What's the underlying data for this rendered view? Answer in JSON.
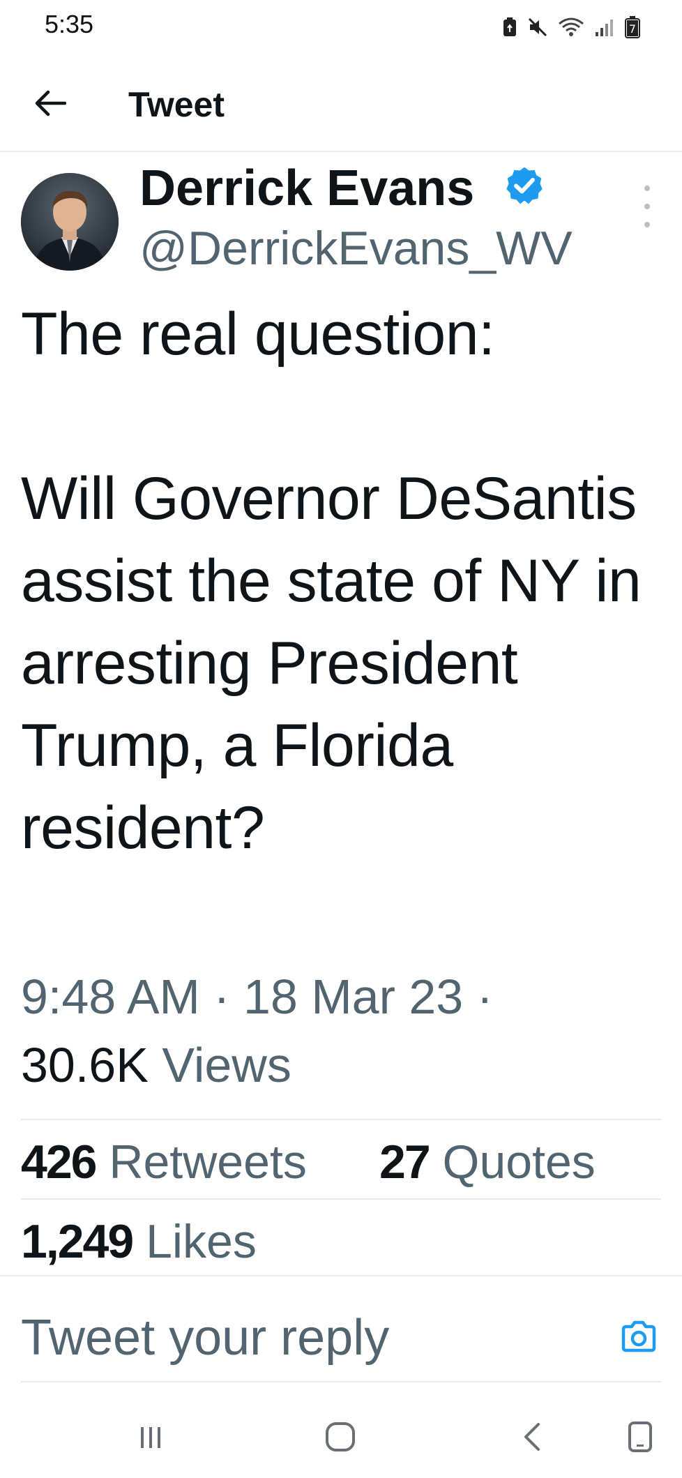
{
  "status_bar": {
    "time": "5:35",
    "icons": [
      "battery-saver-icon",
      "mute-icon",
      "wifi-icon",
      "signal-icon",
      "battery-icon"
    ],
    "battery_level": "7"
  },
  "header": {
    "title": "Tweet",
    "back_icon": "back-arrow-icon"
  },
  "author": {
    "name": "Derrick Evans",
    "handle": "@DerrickEvans_WV",
    "verified": true,
    "avatar_icon": "avatar"
  },
  "tweet": {
    "text": "The real question:\n\nWill Governor DeSantis assist the state of NY in arresting President Trump, a Florida resident?",
    "time": "9:48 AM",
    "date": "18 Mar 23",
    "separator": "·",
    "views_count": "30.6K",
    "views_label": "Views"
  },
  "stats": {
    "retweets_count": "426",
    "retweets_label": "Retweets",
    "quotes_count": "27",
    "quotes_label": "Quotes",
    "likes_count": "1,249",
    "likes_label": "Likes"
  },
  "reply": {
    "placeholder": "Tweet your reply",
    "camera_icon": "camera-icon"
  },
  "colors": {
    "text_primary": "#0f1419",
    "text_secondary": "#536471",
    "accent": "#1d9bf0",
    "divider": "#e6e9ec"
  },
  "nav_bar": {
    "icons": [
      "recent-apps-icon",
      "home-icon",
      "back-icon",
      "screenshot-icon"
    ]
  }
}
